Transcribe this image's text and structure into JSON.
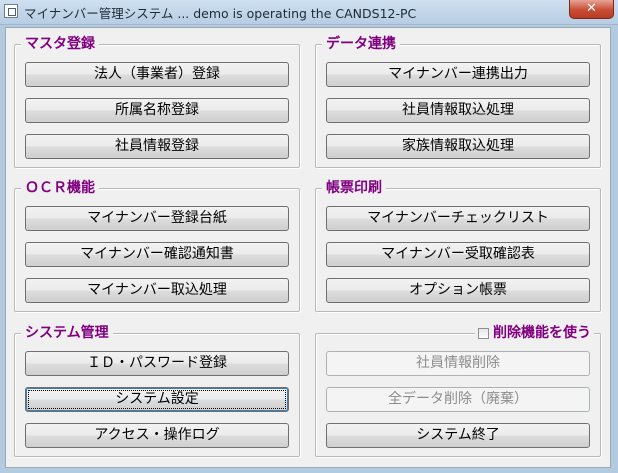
{
  "window": {
    "title": "マイナンバー管理システム ... demo is operating the CANDS12-PC",
    "close_label": "✕"
  },
  "groups": {
    "master": {
      "title": "マスタ登録",
      "buttons": [
        "法人（事業者）登録",
        "所属名称登録",
        "社員情報登録"
      ]
    },
    "data_link": {
      "title": "データ連携",
      "buttons": [
        "マイナンバー連携出力",
        "社員情報取込処理",
        "家族情報取込処理"
      ]
    },
    "ocr": {
      "title": "ＯＣＲ機能",
      "buttons": [
        "マイナンバー登録台紙",
        "マイナンバー確認通知書",
        "マイナンバー取込処理"
      ]
    },
    "report": {
      "title": "帳票印刷",
      "buttons": [
        "マイナンバーチェックリスト",
        "マイナンバー受取確認表",
        "オプション帳票"
      ]
    },
    "system": {
      "title": "システム管理",
      "buttons": [
        "ＩＤ・パスワード登録",
        "システム設定",
        "アクセス・操作ログ"
      ]
    },
    "delete": {
      "checkbox_label": "削除機能を使う",
      "checkbox_checked": false,
      "buttons": [
        "社員情報削除",
        "全データ削除（廃棄）",
        "システム終了"
      ]
    }
  },
  "colors": {
    "legend": "#800080",
    "client_bg": "#f0f0f0",
    "window_frame": "#b4cadf",
    "close_button": "#c94d35"
  }
}
